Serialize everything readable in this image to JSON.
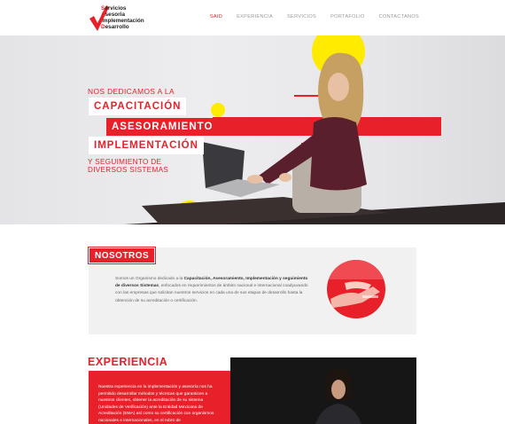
{
  "brand": {
    "logo_lines": [
      {
        "cap": "S",
        "rest": "ervicios"
      },
      {
        "cap": "A",
        "rest": "sesoria"
      },
      {
        "cap": "I",
        "rest": "mplementación"
      },
      {
        "cap": "D",
        "rest": "esarrollo"
      }
    ],
    "accent_color": "#e8202a",
    "yellow_color": "#ffeb00"
  },
  "nav": {
    "items": [
      {
        "label": "SAID",
        "active": true
      },
      {
        "label": "EXPERIENCIA",
        "active": false
      },
      {
        "label": "SERVICIOS",
        "active": false
      },
      {
        "label": "PORTAFOLIO",
        "active": false
      },
      {
        "label": "CONTACTANOS",
        "active": false
      }
    ]
  },
  "hero": {
    "intro": "NOS DEDICAMOS A LA",
    "tags": [
      "CAPACITACIÓN",
      "ASESORAMIENTO",
      "IMPLEMENTACIÓN"
    ],
    "outro": "Y SEGUIMIENTO DE DIVERSOS SISTEMAS"
  },
  "nosotros": {
    "label": "NOSOTROS",
    "text_1": "Somos un Organismo dedicado a la ",
    "text_bold": "Capacitación, Asesoramiento, Implementación y seguimiento de diversos Sistemas",
    "text_2": ", enfocados en requerimientos de ámbito nacional e internacional coadyuvando con las empresas que solicitan nuestros servicios en cada una de sus etapas de desarrollo hasta la obtención de su acreditación o certificación."
  },
  "experiencia": {
    "title": "EXPERIENCIA",
    "text": "Nuestra experiencia en la implementación y asesoría nos ha permitido desarrollar métodos y técnicas que garanticen a nuestros clientes, obtener la acreditación de su sistema (Unidades de Verificación) ante la Entidad Mexicana de Acreditación (EMA) así como su certificación con organismos nacionales e internacionales, en el rubro de"
  }
}
